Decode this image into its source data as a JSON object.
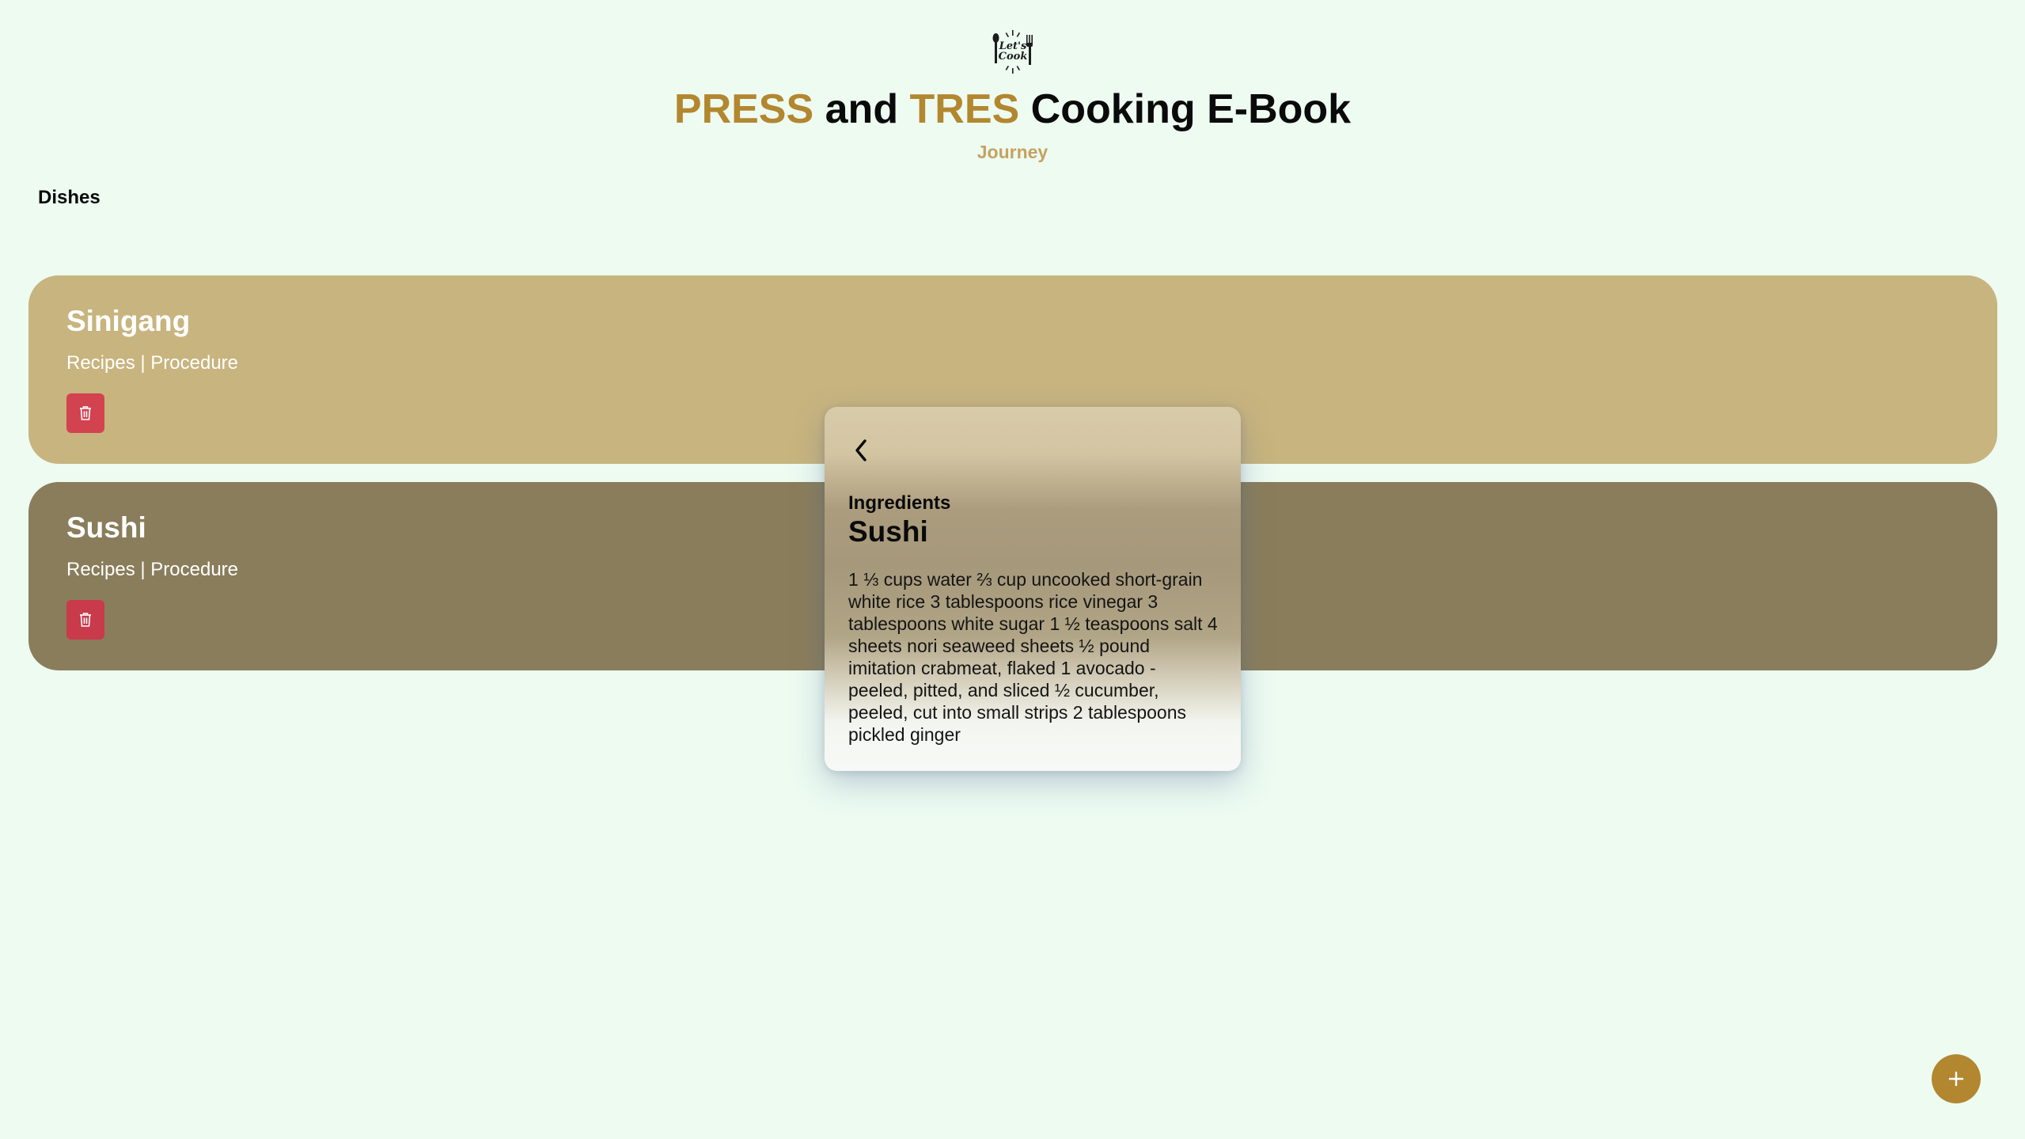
{
  "header": {
    "logo_text_line1": "Let's",
    "logo_text_line2": "Cook",
    "title_part1": "PRESS",
    "title_part2": " and ",
    "title_part3": "TRES",
    "title_part4": " Cooking E-Book",
    "subtitle": "Journey"
  },
  "nav": {
    "dishes_label": "Dishes"
  },
  "dishes": [
    {
      "name": "Sinigang",
      "links": "Recipes | Procedure",
      "delete_icon": "trash-icon"
    },
    {
      "name": "Sushi",
      "links": "Recipes | Procedure",
      "delete_icon": "trash-icon"
    }
  ],
  "modal": {
    "back_icon": "chevron-left-icon",
    "label": "Ingredients",
    "title": "Sushi",
    "body": "1 ⅓ cups water ⅔ cup uncooked short-grain white rice 3 tablespoons rice vinegar 3 tablespoons white sugar 1 ½ teaspoons salt 4 sheets nori seaweed sheets ½ pound imitation crabmeat, flaked 1 avocado - peeled, pitted, and sliced ½ cucumber, peeled, cut into small strips 2 tablespoons pickled ginger"
  },
  "fab": {
    "icon": "plus-icon"
  },
  "colors": {
    "background": "#edfbf1",
    "accent": "#b3872f",
    "subtitle": "#c6a261",
    "card_1": "#c8b47e",
    "card_2": "#8a7d5b",
    "delete": "#d2434f"
  }
}
